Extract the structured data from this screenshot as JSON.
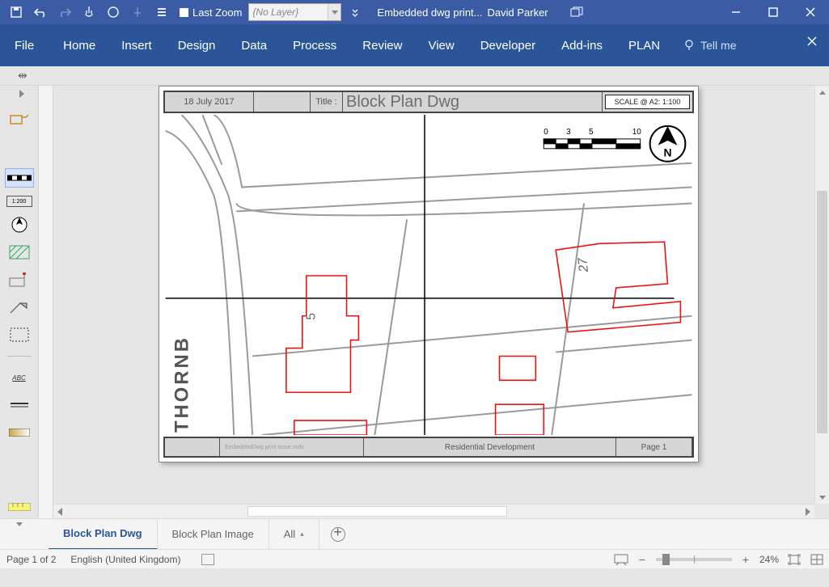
{
  "titlebar": {
    "last_zoom_label": "Last Zoom",
    "layer_box": "{No Layer}",
    "doc_title": "Embedded dwg print...",
    "user": "David Parker"
  },
  "ribbon": {
    "file": "File",
    "tabs": [
      "Home",
      "Insert",
      "Design",
      "Data",
      "Process",
      "Review",
      "View",
      "Developer",
      "Add-ins",
      "PLAN"
    ],
    "tell_me": "Tell me"
  },
  "drawing": {
    "date": "18 July 2017",
    "title_label": "Title :",
    "title": "Block Plan Dwg",
    "scale": "SCALE @ A2:  1:100",
    "scalebar": [
      "0",
      "3",
      "5",
      "10"
    ],
    "street": "THORNB",
    "house_no_1": "5",
    "house_no_2": "27",
    "filename": "EmbeddedDwg print issue.vsdx",
    "project": "Residential Development",
    "page_label": "Page 1"
  },
  "pagetabs": {
    "active": "Block Plan Dwg",
    "other": "Block Plan Image",
    "all": "All"
  },
  "status": {
    "page": "Page 1 of 2",
    "lang": "English (United Kingdom)",
    "zoom": "24%"
  }
}
